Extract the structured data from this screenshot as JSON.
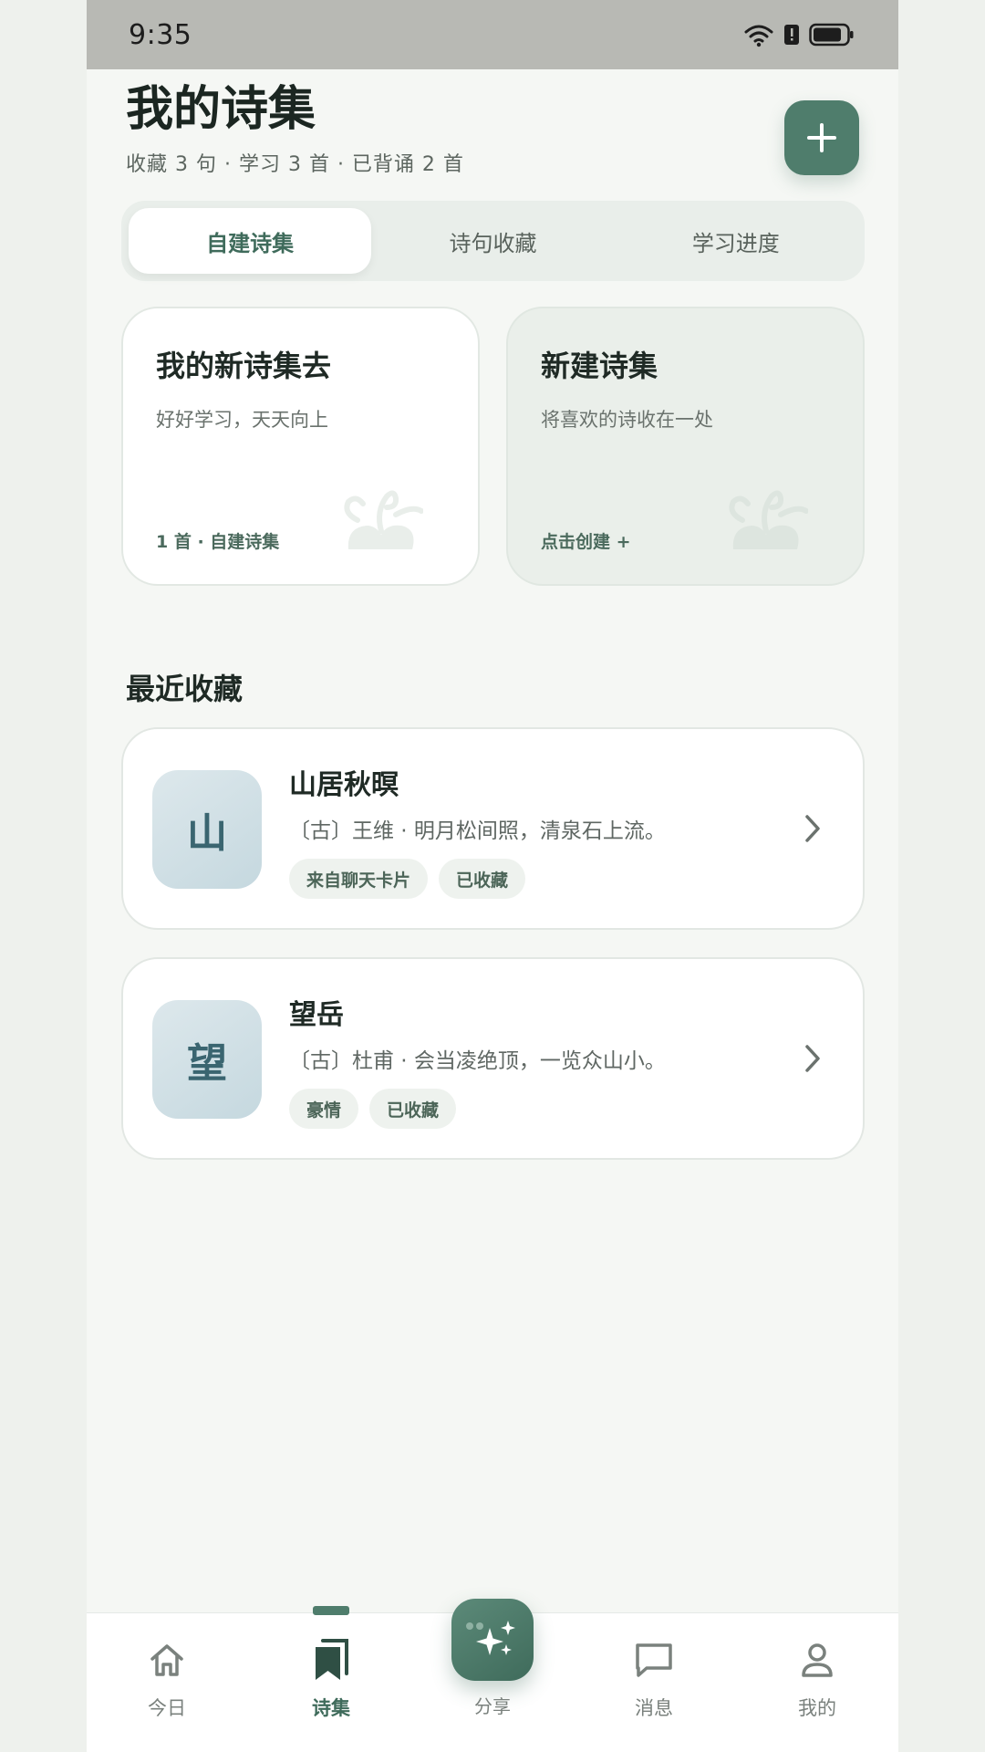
{
  "status_bar": {
    "time": "9:35",
    "icons": [
      "wifi-icon",
      "alert-icon",
      "battery-icon"
    ]
  },
  "header": {
    "title": "我的诗集",
    "subtitle": "收藏 3 句 · 学习 3 首 · 已背诵 2 首",
    "add_icon": "plus-icon"
  },
  "tabs": [
    {
      "label": "自建诗集",
      "active": true
    },
    {
      "label": "诗句收藏",
      "active": false
    },
    {
      "label": "学习进度",
      "active": false
    }
  ],
  "collections": [
    {
      "title": "我的新诗集去",
      "desc": "好好学习，天天向上",
      "meta": "1 首 · 自建诗集"
    },
    {
      "title": "新建诗集",
      "desc": "将喜欢的诗收在一处",
      "meta": "点击创建 +"
    }
  ],
  "recent": {
    "section_title": "最近收藏",
    "items": [
      {
        "avatar": "山",
        "title": "山居秋暝",
        "line": "〔古〕王维 · 明月松间照，清泉石上流。",
        "tags": [
          "来自聊天卡片",
          "已收藏"
        ]
      },
      {
        "avatar": "望",
        "title": "望岳",
        "line": "〔古〕杜甫 · 会当凌绝顶，一览众山小。",
        "tags": [
          "豪情",
          "已收藏"
        ]
      }
    ]
  },
  "bottom_nav": {
    "items": [
      {
        "label": "今日",
        "icon": "home-icon",
        "active": false
      },
      {
        "label": "诗集",
        "icon": "book-icon",
        "active": true
      },
      {
        "label": "分享",
        "icon": "sparkle-icon",
        "active": false
      },
      {
        "label": "消息",
        "icon": "message-icon",
        "active": false
      },
      {
        "label": "我的",
        "icon": "user-icon",
        "active": false
      }
    ]
  },
  "colors": {
    "accent": "#4f7d6c",
    "background": "#f5f7f4",
    "card": "#ffffff",
    "status_bar": "#b8b9b4"
  }
}
